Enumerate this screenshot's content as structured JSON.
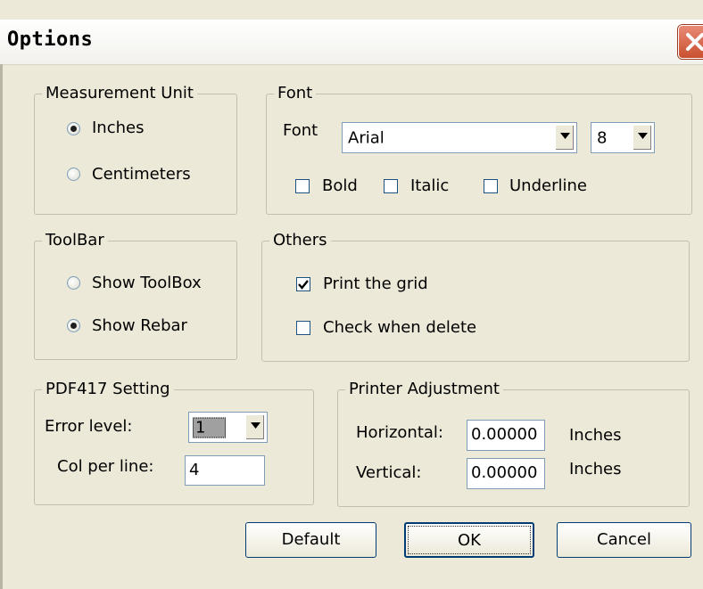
{
  "window": {
    "title": "Options",
    "close_icon": "close-icon"
  },
  "measurement_unit": {
    "legend": "Measurement Unit",
    "options": [
      {
        "label": "Inches",
        "selected": true
      },
      {
        "label": "Centimeters",
        "selected": false
      }
    ]
  },
  "font": {
    "legend": "Font",
    "font_label": "Font",
    "font_value": "Arial",
    "size_value": "8",
    "styles": [
      {
        "label": "Bold",
        "checked": false
      },
      {
        "label": "Italic",
        "checked": false
      },
      {
        "label": "Underline",
        "checked": false
      }
    ]
  },
  "toolbar": {
    "legend": "ToolBar",
    "options": [
      {
        "label": "Show ToolBox",
        "selected": false
      },
      {
        "label": "Show Rebar",
        "selected": true
      }
    ]
  },
  "others": {
    "legend": "Others",
    "options": [
      {
        "label": "Print the grid",
        "checked": true
      },
      {
        "label": "Check when delete",
        "checked": false
      }
    ]
  },
  "pdf417": {
    "legend": "PDF417 Setting",
    "error_label": "Error level:",
    "error_value": "1",
    "col_label": "Col per line:",
    "col_value": "4"
  },
  "printer": {
    "legend": "Printer Adjustment",
    "horizontal_label": "Horizontal:",
    "horizontal_value": "0.00000",
    "horizontal_unit": "Inches",
    "vertical_label": "Vertical:",
    "vertical_value": "0.00000",
    "vertical_unit": "Inches"
  },
  "buttons": {
    "default": "Default",
    "ok": "OK",
    "cancel": "Cancel"
  }
}
